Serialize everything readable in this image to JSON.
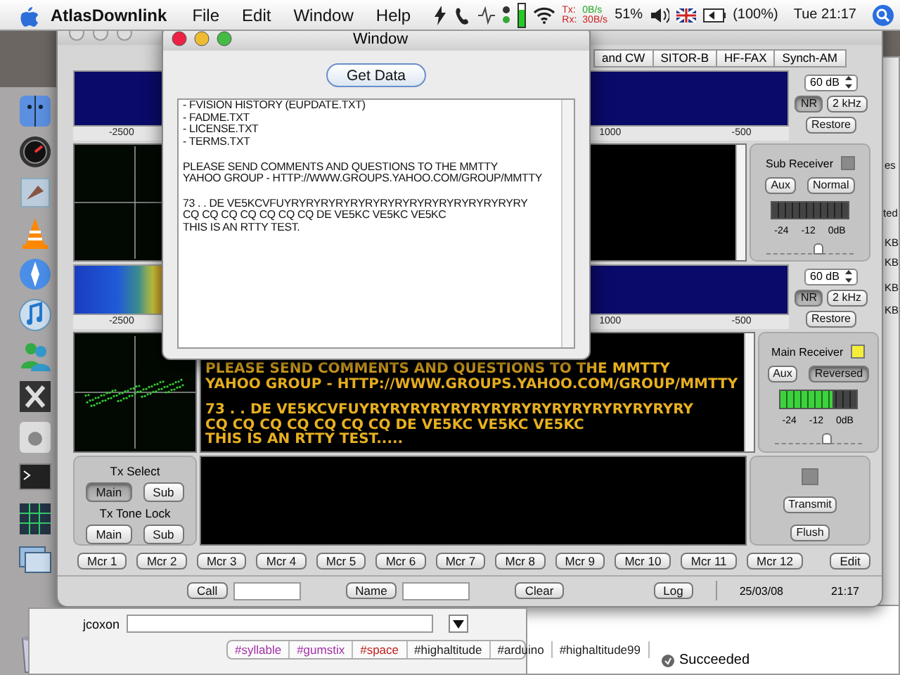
{
  "menu_bar": {
    "app_name": "AtlasDownlink",
    "menus": [
      "File",
      "Edit",
      "Window",
      "Help"
    ],
    "tx_label": "Tx:",
    "tx_rate": "0B/s",
    "rx_label": "Rx:",
    "rx_rate": "30B/s",
    "cpu_load": "51%",
    "battery": "(100%)",
    "clock": "Tue 21:17"
  },
  "dialog": {
    "title": "Window",
    "button": "Get Data",
    "paragraphs": [
      [
        "- FVISION HISTORY (EUPDATE.TXT)",
        "- FADME.TXT",
        "- LICENSE.TXT",
        "- TERMS.TXT"
      ],
      [
        "PLEASE SEND COMMENTS AND QUESTIONS TO THE MMTTY",
        "YAHOO GROUP - HTTP://WWW.GROUPS.YAHOO.COM/GROUP/MMTTY"
      ],
      [
        "73 . .  DE VE5KCVFUYRYRYRYRYRYRYRYRYRYRYRYRYRYRYRYRY",
        "CQ CQ CQ CQ CQ CQ CQ DE VE5KC VE5KC VE5KC",
        "THIS IS AN RTTY TEST."
      ]
    ]
  },
  "radio": {
    "tabs": [
      {
        "label": "and CW",
        "selected": false
      },
      {
        "label": "SITOR-B",
        "selected": false
      },
      {
        "label": "HF-FAX",
        "selected": false
      },
      {
        "label": "Synch-AM",
        "selected": false
      }
    ],
    "spectrums": [
      {
        "kind": "spectrum",
        "axis_labels": [
          "-2500",
          "1000",
          "-500"
        ],
        "range": "60 dB",
        "nr": {
          "label": "NR",
          "selected": true
        },
        "bandwidth": "2 kHz",
        "restore": "Restore"
      },
      {
        "kind": "waterfall",
        "axis_labels": [
          "-2500",
          "1000",
          "-500"
        ],
        "range": "60 dB",
        "nr": {
          "label": "NR",
          "selected": true
        },
        "bandwidth": "2 kHz",
        "restore": "Restore"
      }
    ],
    "receivers": [
      {
        "title": "Sub Receiver",
        "on": false,
        "aux": "Aux",
        "mode": {
          "label": "Normal",
          "selected": false
        },
        "meter": {
          "level": 0
        },
        "scale": [
          "-24",
          "-12",
          "0dB"
        ],
        "slider": {
          "level": 0.6
        }
      },
      {
        "title": "Main Receiver",
        "on": true,
        "aux": "Aux",
        "mode": {
          "label": "Reversed",
          "selected": true
        },
        "meter": {
          "level": 0.7
        },
        "scale": [
          "-24",
          "-12",
          "0dB"
        ],
        "slider": {
          "level": 0.6
        }
      }
    ],
    "rx_text": [
      [
        "PLEASE SEND COMMENTS AND QUESTIONS TO THE MMTTY",
        "YAHOO GROUP - HTTP://WWW.GROUPS.YAHOO.COM/GROUP/MMTTY"
      ],
      [
        "73 . .  DE VE5KCVFUYRYRYRYRYRYRYRYRYRYRYRYRYRYRYRYRY",
        "CQ CQ CQ CQ CQ CQ CQ DE VE5KC VE5KC VE5KC",
        "THIS IS AN RTTY TEST....."
      ]
    ],
    "tx_groups": [
      {
        "title": "Tx Select",
        "buttons": [
          {
            "label": "Main",
            "selected": true
          },
          {
            "label": "Sub",
            "selected": false
          }
        ]
      },
      {
        "title": "Tx Tone Lock",
        "buttons": [
          {
            "label": "Main",
            "selected": false
          },
          {
            "label": "Sub",
            "selected": false
          }
        ]
      }
    ],
    "transmit": {
      "on": false,
      "transmit": "Transmit",
      "flush": "Flush"
    },
    "macros": [
      "Mcr 1",
      "Mcr 2",
      "Mcr 3",
      "Mcr 4",
      "Mcr 5",
      "Mcr 6",
      "Mcr 7",
      "Mcr 8",
      "Mcr 9",
      "Mcr 10",
      "Mcr 11",
      "Mcr 12"
    ],
    "edit": "Edit",
    "log_bar": {
      "call": "Call",
      "name": "Name",
      "clear": "Clear",
      "log": "Log",
      "date": "25/03/08",
      "time": "21:17"
    }
  },
  "chat": {
    "user": "jcoxon",
    "tags": [
      {
        "label": "#syllable",
        "color": "#a030a8"
      },
      {
        "label": "#gumstix",
        "color": "#a030a8"
      },
      {
        "label": "#space",
        "color": "#c02020"
      },
      {
        "label": "#highaltitude",
        "color": "#202020"
      },
      {
        "label": "#arduino",
        "color": "#202020"
      },
      {
        "label": "#highaltitude99",
        "color": "#202020"
      }
    ]
  },
  "status": {
    "text": "Succeeded"
  },
  "background_fragments": [
    "es",
    "ted",
    "KB",
    "KB",
    "KB",
    "KB"
  ]
}
